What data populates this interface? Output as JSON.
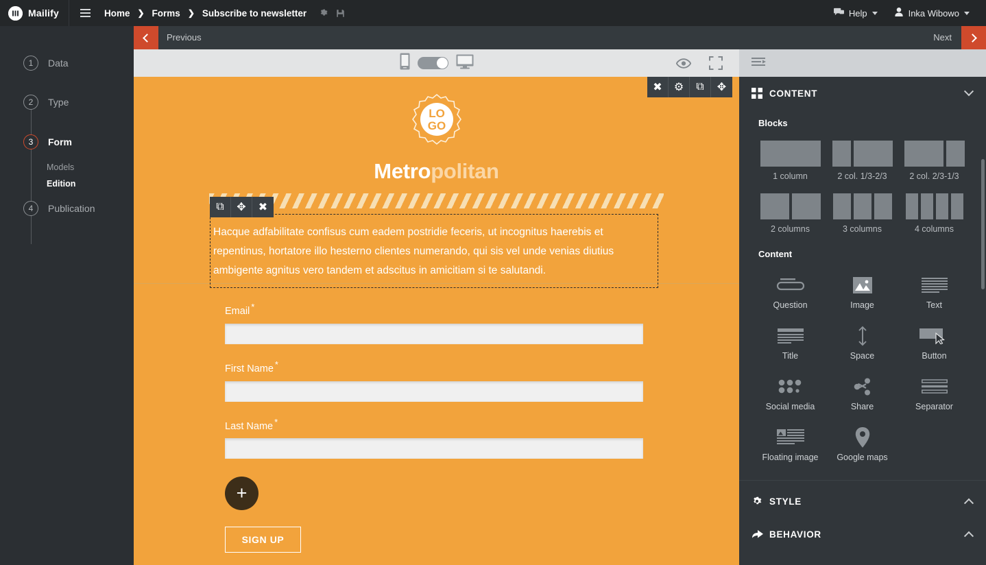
{
  "topbar": {
    "brand": "Mailify",
    "menu_icon": "hamburger-icon",
    "breadcrumbs": [
      {
        "label": "Home"
      },
      {
        "label": "Forms"
      },
      {
        "label": "Subscribe to newsletter"
      }
    ],
    "tools": [
      {
        "name": "settings-gear-icon"
      },
      {
        "name": "save-disk-icon"
      }
    ],
    "help": "Help",
    "user": "Inka Wibowo"
  },
  "steps": [
    {
      "num": "1",
      "label": "Data",
      "active": false
    },
    {
      "num": "2",
      "label": "Type",
      "active": false
    },
    {
      "num": "3",
      "label": "Form",
      "active": true
    },
    {
      "num": "4",
      "label": "Publication",
      "active": false
    }
  ],
  "substeps": [
    {
      "label": "Models",
      "selected": false
    },
    {
      "label": "Edition",
      "selected": true
    }
  ],
  "nav": {
    "previous": "Previous",
    "next": "Next"
  },
  "preview_toolbar": {
    "mobile_icon": "mobile-phone-icon",
    "desktop_icon": "desktop-monitor-icon",
    "toggle_state": "desktop",
    "preview_icon": "eye-icon",
    "fullscreen_icon": "fullscreen-icon"
  },
  "canvas": {
    "block_toolbar": [
      {
        "name": "close-icon",
        "glyph": "✖"
      },
      {
        "name": "settings-gear-icon",
        "glyph": "⚙"
      },
      {
        "name": "duplicate-icon",
        "glyph": "⧉"
      },
      {
        "name": "move-icon",
        "glyph": "✥"
      }
    ],
    "text_toolbar": [
      {
        "name": "duplicate-icon",
        "glyph": "⧉"
      },
      {
        "name": "move-icon",
        "glyph": "✥"
      },
      {
        "name": "close-icon",
        "glyph": "✖"
      }
    ],
    "logo_text_top": "LO",
    "logo_text_bottom": "GO",
    "brand_part1": "Metro",
    "brand_part2": "politan",
    "body_text": "Hacque adfabilitate confisus cum eadem postridie feceris, ut incognitus haerebis et repentinus, hortatore illo hesterno clientes numerando, qui sis vel unde venias diutius ambigente agnitus vero tandem et adscitus in amicitiam si te salutandi.",
    "fields": [
      {
        "label": "Email",
        "required": "*",
        "value": "",
        "placeholder": ""
      },
      {
        "label": "First Name",
        "required": "*",
        "value": "",
        "placeholder": ""
      },
      {
        "label": "Last Name",
        "required": "*",
        "value": "",
        "placeholder": ""
      }
    ],
    "add_field_label": "+",
    "submit_label": "SIGN UP",
    "background_color": "#f2a33c"
  },
  "right_panel": {
    "collapse_icon": "collapse-panel-icon",
    "sections": [
      {
        "title": "CONTENT",
        "icon": "grid-icon",
        "expanded": true
      },
      {
        "title": "STYLE",
        "icon": "gear-icon",
        "expanded": false
      },
      {
        "title": "BEHAVIOR",
        "icon": "arrow-curve-icon",
        "expanded": false
      }
    ],
    "blocks_heading": "Blocks",
    "blocks": [
      {
        "label": "1 column",
        "widths": [
          84
        ]
      },
      {
        "label": "2 col. 1/3-2/3",
        "widths": [
          26,
          54
        ]
      },
      {
        "label": "2 col. 2/3-1/3",
        "widths": [
          54,
          26
        ]
      },
      {
        "label": "2 columns",
        "widths": [
          40,
          40
        ]
      },
      {
        "label": "3 columns",
        "widths": [
          26,
          26,
          26
        ]
      },
      {
        "label": "4 columns",
        "widths": [
          18,
          18,
          18,
          18
        ]
      }
    ],
    "content_heading": "Content",
    "content_items": [
      {
        "label": "Question",
        "icon": "question-field-icon"
      },
      {
        "label": "Image",
        "icon": "image-icon"
      },
      {
        "label": "Text",
        "icon": "text-lines-icon"
      },
      {
        "label": "Title",
        "icon": "title-icon"
      },
      {
        "label": "Space",
        "icon": "vertical-arrows-icon"
      },
      {
        "label": "Button",
        "icon": "button-cursor-icon"
      },
      {
        "label": "Social media",
        "icon": "social-dots-icon"
      },
      {
        "label": "Share",
        "icon": "share-icon"
      },
      {
        "label": "Separator",
        "icon": "separator-icon"
      },
      {
        "label": "Floating image",
        "icon": "floating-image-icon"
      },
      {
        "label": "Google maps",
        "icon": "map-pin-icon"
      }
    ]
  }
}
